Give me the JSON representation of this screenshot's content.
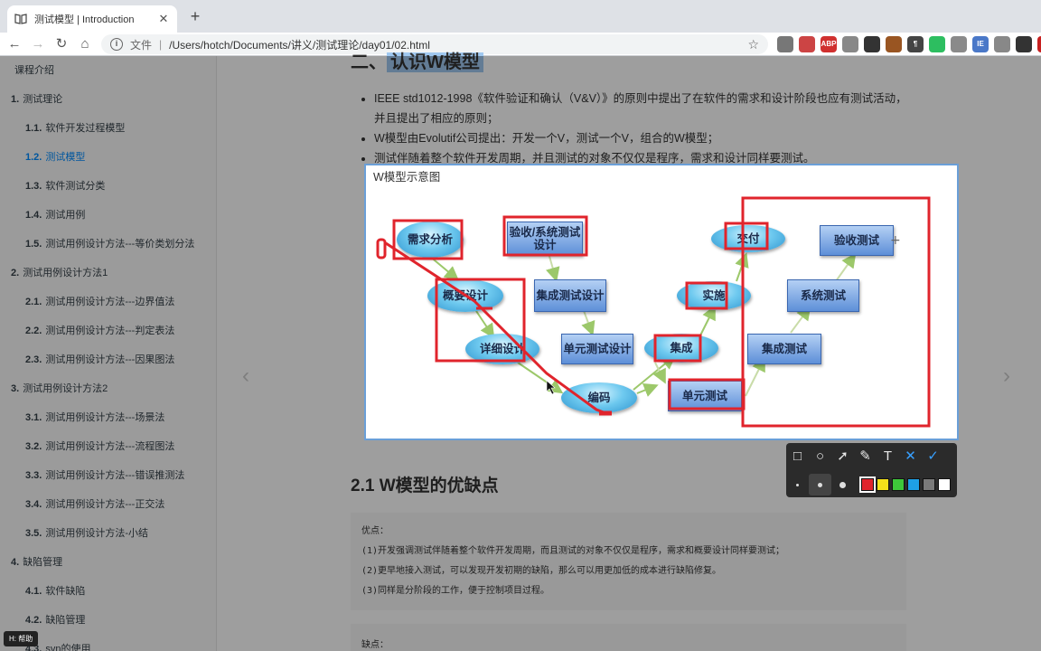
{
  "browser": {
    "tab_title": "测试模型 | Introduction",
    "tab_close": "✕",
    "new_tab": "+",
    "url_scheme": "文件",
    "url_separator": "|",
    "url": "/Users/hotch/Documents/讲义/测试理论/day01/02.html",
    "bookmark_star": "☆",
    "extensions": [
      {
        "name": "ext-circle-icon",
        "label": "",
        "color": "#777777"
      },
      {
        "name": "ext-pin-icon",
        "label": "",
        "color": "#cc4444"
      },
      {
        "name": "ext-adblock-icon",
        "label": "ABP",
        "color": "#d0302f"
      },
      {
        "name": "ext-gear-icon",
        "label": "",
        "color": "#888888"
      },
      {
        "name": "ext-robot-icon",
        "label": "",
        "color": "#333333"
      },
      {
        "name": "ext-puzzle-icon",
        "label": "",
        "color": "#995522"
      },
      {
        "name": "ext-paragraph-icon",
        "label": "¶",
        "color": "#444444"
      },
      {
        "name": "ext-evernote-icon",
        "label": "",
        "color": "#2dbe60"
      },
      {
        "name": "ext-cube-icon",
        "label": "",
        "color": "#8a8a8a"
      },
      {
        "name": "ext-ie-icon",
        "label": "IE",
        "color": "#4a78c8"
      },
      {
        "name": "ext-shield-icon",
        "label": "",
        "color": "#888888"
      },
      {
        "name": "ext-user-icon",
        "label": "",
        "color": "#333333"
      },
      {
        "name": "ext-stop-icon",
        "label": "",
        "color": "#c82020"
      }
    ]
  },
  "sidebar": {
    "items": [
      {
        "label": "课程介绍",
        "num": "",
        "level": 1,
        "active": false
      },
      {
        "label": "测试理论",
        "num": "1.",
        "level": 1,
        "active": false
      },
      {
        "label": "软件开发过程模型",
        "num": "1.1.",
        "level": 2,
        "active": false
      },
      {
        "label": "测试模型",
        "num": "1.2.",
        "level": 2,
        "active": true
      },
      {
        "label": "软件测试分类",
        "num": "1.3.",
        "level": 2,
        "active": false
      },
      {
        "label": "测试用例",
        "num": "1.4.",
        "level": 2,
        "active": false
      },
      {
        "label": "测试用例设计方法---等价类划分法",
        "num": "1.5.",
        "level": 2,
        "active": false
      },
      {
        "label": "测试用例设计方法1",
        "num": "2.",
        "level": 1,
        "active": false
      },
      {
        "label": "测试用例设计方法---边界值法",
        "num": "2.1.",
        "level": 2,
        "active": false
      },
      {
        "label": "测试用例设计方法---判定表法",
        "num": "2.2.",
        "level": 2,
        "active": false
      },
      {
        "label": "测试用例设计方法---因果图法",
        "num": "2.3.",
        "level": 2,
        "active": false
      },
      {
        "label": "测试用例设计方法2",
        "num": "3.",
        "level": 1,
        "active": false
      },
      {
        "label": "测试用例设计方法---场景法",
        "num": "3.1.",
        "level": 2,
        "active": false
      },
      {
        "label": "测试用例设计方法---流程图法",
        "num": "3.2.",
        "level": 2,
        "active": false
      },
      {
        "label": "测试用例设计方法---错误推测法",
        "num": "3.3.",
        "level": 2,
        "active": false
      },
      {
        "label": "测试用例设计方法---正交法",
        "num": "3.4.",
        "level": 2,
        "active": false
      },
      {
        "label": "测试用例设计方法-小结",
        "num": "3.5.",
        "level": 2,
        "active": false
      },
      {
        "label": "缺陷管理",
        "num": "4.",
        "level": 1,
        "active": false
      },
      {
        "label": "软件缺陷",
        "num": "4.1.",
        "level": 2,
        "active": false
      },
      {
        "label": "缺陷管理",
        "num": "4.2.",
        "level": 2,
        "active": false
      },
      {
        "label": "svn的使用",
        "num": "4.3.",
        "level": 2,
        "active": false
      }
    ]
  },
  "content": {
    "heading_top_prefix": "二、",
    "heading_top_highlight": "认识W模型",
    "bullets": [
      "IEEE std1012-1998《软件验证和确认（V&V）》的原则中提出了在软件的需求和设计阶段也应有测试活动，并且提出了相应的原则；",
      "W模型由Evolutif公司提出：开发一个V，测试一个V，组合的W模型；",
      "测试伴随着整个软件开发周期，并且测试的对象不仅仅是程序，需求和设计同样要测试。"
    ],
    "section_heading": "2.1 W模型的优缺点",
    "pros_title": "优点：",
    "pros": [
      "(1)开发强调测试伴随着整个软件开发周期，而且测试的对象不仅仅是程序，需求和概要设计同样要测试；",
      "(2)更早地接入测试，可以发现开发初期的缺陷，那么可以用更加低的成本进行缺陷修复。",
      "(3)同样是分阶段的工作，便于控制项目过程。"
    ],
    "cons_title": "缺点：",
    "prev_arrow": "‹",
    "next_arrow": "›"
  },
  "selection": {
    "caption": "W模型示意图",
    "nodes": [
      {
        "name": "node-requirements-analysis",
        "label": "需求分析",
        "shape": "ellipse"
      },
      {
        "name": "node-acceptance-system-test-design",
        "label": "验收/系统测试设计",
        "shape": "rect"
      },
      {
        "name": "node-delivery",
        "label": "交付",
        "shape": "ellipse"
      },
      {
        "name": "node-acceptance-test",
        "label": "验收测试",
        "shape": "rect"
      },
      {
        "name": "node-high-level-design",
        "label": "概要设计",
        "shape": "ellipse"
      },
      {
        "name": "node-integration-test-design",
        "label": "集成测试设计",
        "shape": "rect"
      },
      {
        "name": "node-implementation",
        "label": "实施",
        "shape": "ellipse"
      },
      {
        "name": "node-system-test",
        "label": "系统测试",
        "shape": "rect"
      },
      {
        "name": "node-detailed-design",
        "label": "详细设计",
        "shape": "ellipse"
      },
      {
        "name": "node-unit-test-design",
        "label": "单元测试设计",
        "shape": "rect"
      },
      {
        "name": "node-integration",
        "label": "集成",
        "shape": "ellipse"
      },
      {
        "name": "node-integration-test",
        "label": "集成测试",
        "shape": "rect"
      },
      {
        "name": "node-coding",
        "label": "编码",
        "shape": "ellipse"
      },
      {
        "name": "node-unit-test",
        "label": "单元测试",
        "shape": "rect"
      }
    ],
    "annotation_color": "#e0242c"
  },
  "annotation_toolbar": {
    "tools": [
      {
        "name": "rectangle-tool-icon",
        "glyph": "□"
      },
      {
        "name": "ellipse-tool-icon",
        "glyph": "○"
      },
      {
        "name": "arrow-tool-icon",
        "glyph": "➚"
      },
      {
        "name": "brush-tool-icon",
        "glyph": "✎"
      },
      {
        "name": "text-tool-icon",
        "glyph": "T"
      },
      {
        "name": "cancel-icon",
        "glyph": "✕"
      },
      {
        "name": "confirm-icon",
        "glyph": "✓"
      }
    ],
    "colors": [
      "#e0242c",
      "#f5e11a",
      "#3ec83a",
      "#1ea0e6",
      "#7a7a7a",
      "#ffffff"
    ],
    "selected_color": "#e0242c"
  },
  "help_tag": "H: 帮助"
}
